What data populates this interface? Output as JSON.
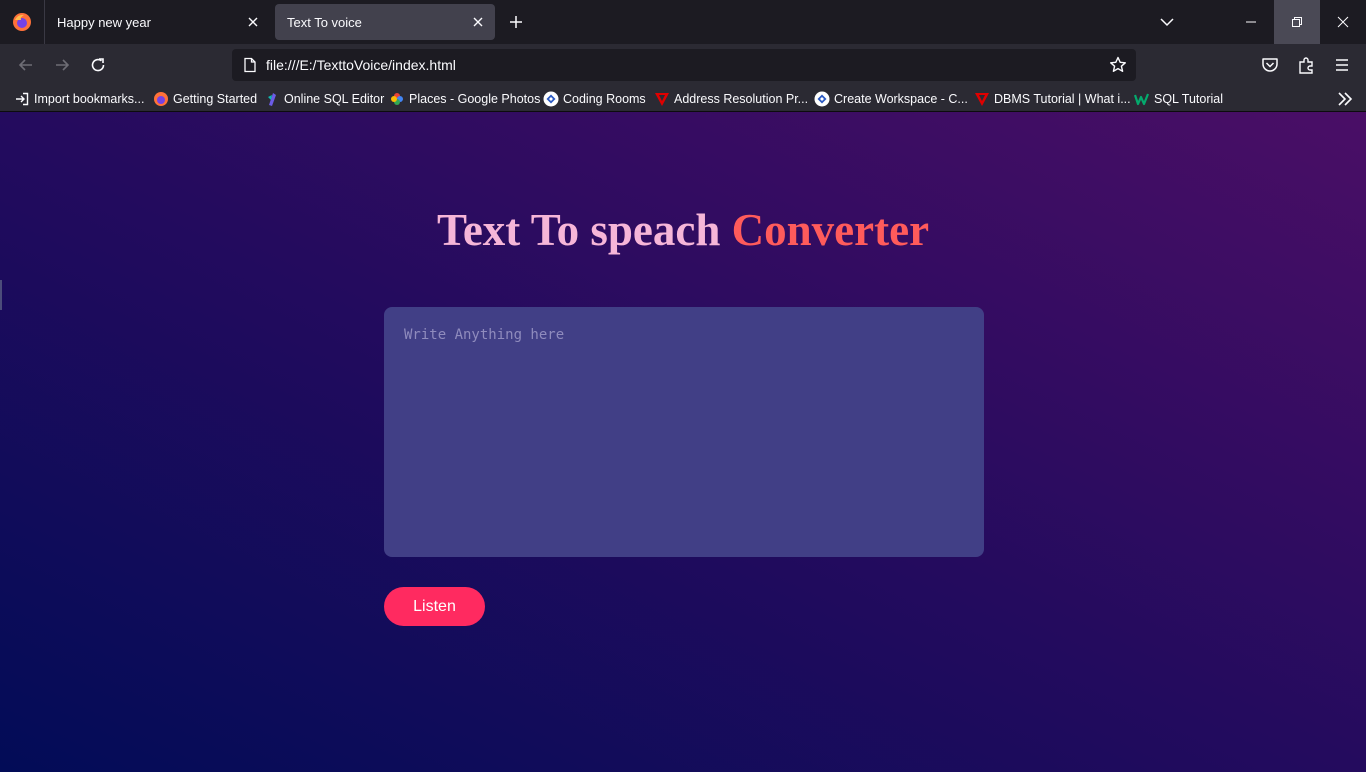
{
  "browser": {
    "tabs": [
      {
        "title": "Happy new year",
        "active": false
      },
      {
        "title": "Text To voice",
        "active": true
      }
    ],
    "url": "file:///E:/TexttoVoice/index.html",
    "bookmarks": [
      {
        "label": "Import bookmarks...",
        "icon": "import-icon"
      },
      {
        "label": "Getting Started",
        "icon": "firefox-icon"
      },
      {
        "label": "Online SQL Editor",
        "icon": "sql-editor-icon"
      },
      {
        "label": "Places - Google Photos",
        "icon": "google-photos-icon"
      },
      {
        "label": "Coding Rooms",
        "icon": "coding-rooms-icon"
      },
      {
        "label": "Address Resolution Pr...",
        "icon": "tutorial-icon"
      },
      {
        "label": "Create Workspace - C...",
        "icon": "coding-rooms-icon"
      },
      {
        "label": "DBMS Tutorial | What i...",
        "icon": "tutorial-icon"
      },
      {
        "label": "SQL Tutorial",
        "icon": "w3schools-icon"
      }
    ]
  },
  "page": {
    "title_main": "Text To speach ",
    "title_accent": "Converter",
    "textarea_placeholder": "Write Anything here",
    "listen_label": "Listen"
  },
  "colors": {
    "title_main": "#f6b6d8",
    "title_accent": "#ff5b5b",
    "textarea_bg": "#413f86",
    "button_bg": "#ff2a60",
    "gradient_start": "#020c57",
    "gradient_end": "#4a0e66"
  }
}
